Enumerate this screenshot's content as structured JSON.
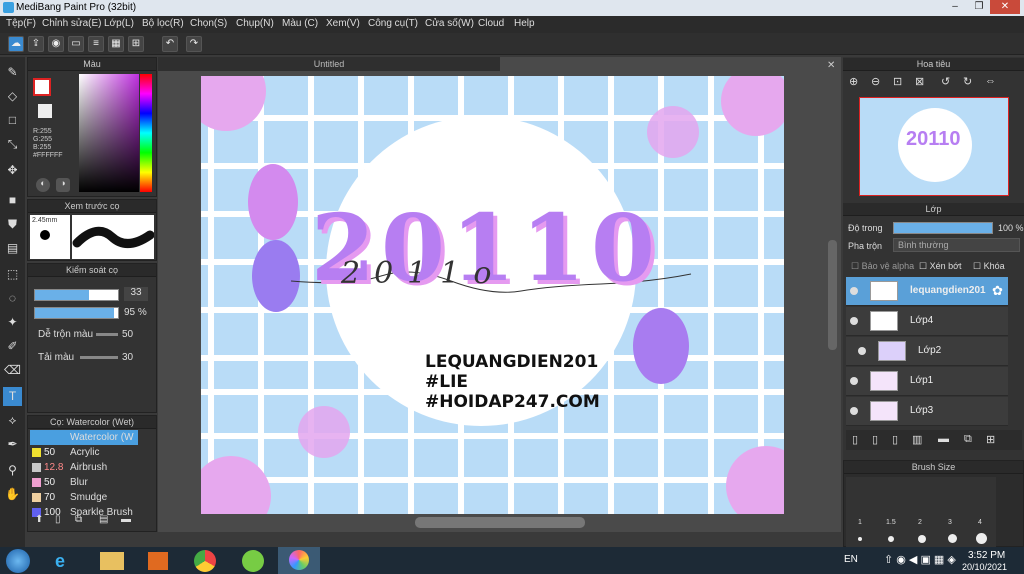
{
  "window": {
    "title": "MediBang Paint Pro (32bit)",
    "min": "–",
    "max": "❐",
    "close": "✕"
  },
  "menu": [
    "Tệp(F)",
    "Chỉnh sửa(E)",
    "Lớp(L)",
    "Bộ lọc(R)",
    "Chọn(S)",
    "Chụp(N)",
    "Màu (C)",
    "Xem(V)",
    "Công cụ(T)",
    "Cửa số(W)",
    "Cloud",
    "Help"
  ],
  "color_panel": {
    "title": "Màu",
    "r": "R:255",
    "g": "G:255",
    "b": "B:255",
    "hex": "#FFFFFF"
  },
  "preview_panel": {
    "title": "Xem trước cọ",
    "size": "2.45mm"
  },
  "brush_control": {
    "title": "Kiểm soát cọ",
    "size_value": "33",
    "opacity_value": "95 %",
    "blend_label": "Dễ trộn màu",
    "blend_value": "50",
    "reload_label": "Tải màu",
    "reload_value": "30"
  },
  "brush_list": {
    "title": "Cọ: Watercolor (Wet)",
    "items": [
      {
        "num": "",
        "name": "Watercolor (W",
        "color": "#4a9fe0"
      },
      {
        "num": "50",
        "name": "Acrylic",
        "color": "#f0e030"
      },
      {
        "num": "12.8",
        "name": "Airbrush",
        "color": "#c8c8c8"
      },
      {
        "num": "50",
        "name": "Blur",
        "color": "#f0a0d0"
      },
      {
        "num": "70",
        "name": "Smudge",
        "color": "#f0d0a0"
      },
      {
        "num": "100",
        "name": "Sparkle Brush",
        "color": "#6060f0"
      }
    ]
  },
  "document": {
    "tab": "Untitled"
  },
  "artwork": {
    "title": "20110",
    "subtitle": "2011o",
    "line1": "LEQUANGDIEN201",
    "line2": "#LIE",
    "line3": "#HOIDAP247.COM"
  },
  "navigator": {
    "title": "Hoa tiêu"
  },
  "layers_panel": {
    "title": "Lớp",
    "opacity_label": "Độ trong",
    "opacity_value": "100 %",
    "blend_label": "Pha trộn",
    "blend_value": "Bình thường",
    "protect_alpha": "Bảo vệ alpha",
    "clip": "Xén bớt",
    "lock": "Khóa",
    "layers": [
      {
        "name": "lequangdien201",
        "selected": true
      },
      {
        "name": "Lớp4",
        "selected": false
      },
      {
        "name": "Lớp2",
        "selected": false
      },
      {
        "name": "Lớp1",
        "selected": false
      },
      {
        "name": "Lớp3",
        "selected": false
      }
    ]
  },
  "brush_size": {
    "title": "Brush Size",
    "labels": [
      "1",
      "1.5",
      "2",
      "3",
      "4"
    ]
  },
  "taskbar": {
    "lang": "EN",
    "time": "3:52 PM",
    "date": "20/10/2021"
  },
  "colors": {
    "accent": "#5aa0d8",
    "artbg": "#b9dcf7",
    "pink": "#e88ae8",
    "purple": "#8a6ef0"
  }
}
